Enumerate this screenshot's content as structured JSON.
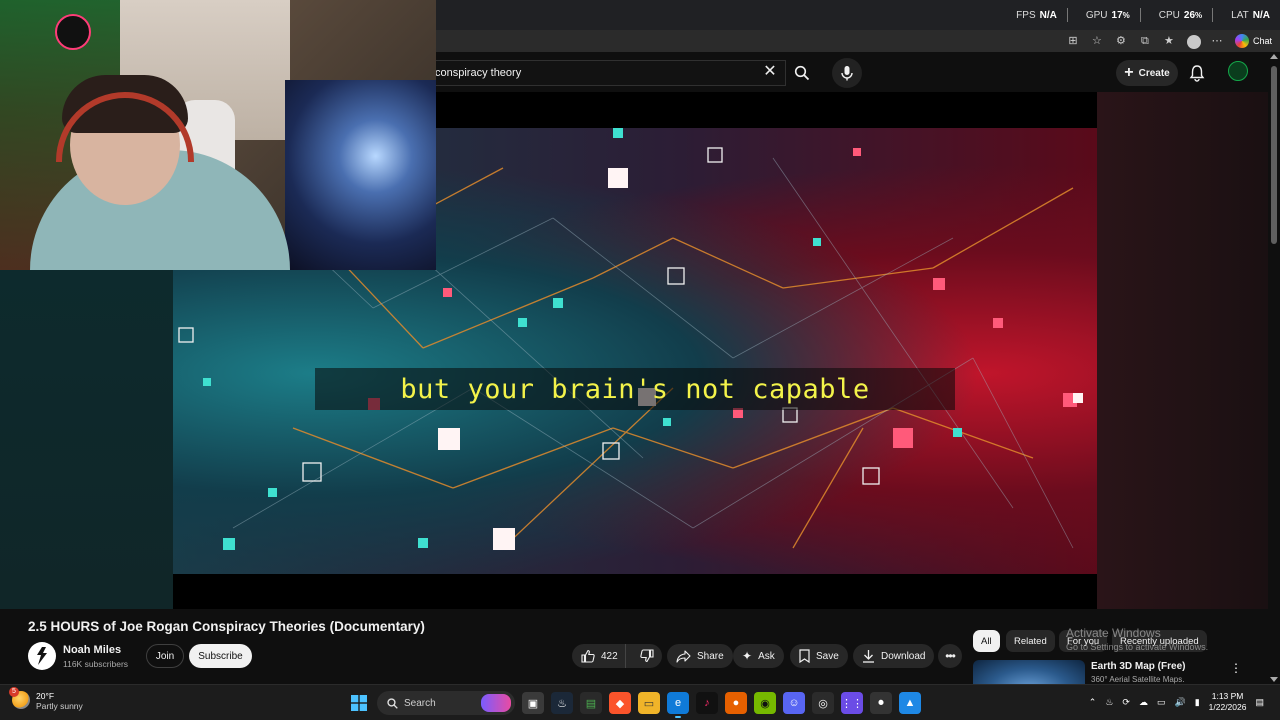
{
  "perf": {
    "fps_label": "FPS",
    "fps_value": "N/A",
    "gpu_label": "GPU",
    "gpu_value": "17",
    "cpu_label": "CPU",
    "cpu_value": "26",
    "lat_label": "LAT",
    "lat_value": "N/A",
    "percent": "%"
  },
  "browser": {
    "chat_label": "Chat"
  },
  "header": {
    "search_value": "conspiracy theory",
    "create_label": "Create"
  },
  "video": {
    "caption": "but your brain's not capable"
  },
  "watch": {
    "title": "2.5 HOURS of Joe Rogan Conspiracy Theories (Documentary)",
    "channel_name": "Noah Miles",
    "channel_subs": "116K subscribers",
    "join_label": "Join",
    "subscribe_label": "Subscribe",
    "like_count": "422",
    "share_label": "Share",
    "ask_label": "Ask",
    "save_label": "Save",
    "download_label": "Download"
  },
  "chips": [
    {
      "label": "All",
      "active": true
    },
    {
      "label": "Related",
      "active": false
    },
    {
      "label": "For you",
      "active": false
    },
    {
      "label": "Recently uploaded",
      "active": false
    }
  ],
  "watermark": {
    "title": "Activate Windows",
    "subtitle": "Go to Settings to activate Windows."
  },
  "recommendation": {
    "title": "Earth 3D Map (Free)",
    "subtitle": "360° Aerial Satellite Maps."
  },
  "taskbar": {
    "weather_badge": "5",
    "weather_temp": "20°F",
    "weather_desc": "Partly sunny",
    "search_label": "Search",
    "time": "1:13 PM",
    "date": "1/22/2026"
  },
  "colors": {
    "accent_blue": "#4cc2ff",
    "caption_yellow": "#f3f34a",
    "subscribe_bg": "#f1f1f1"
  }
}
